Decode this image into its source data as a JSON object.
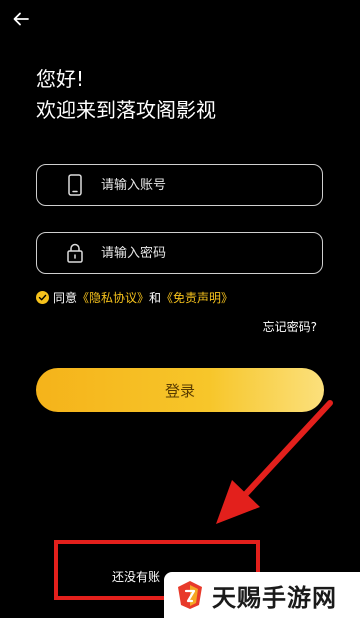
{
  "header": {
    "back_icon": "back-arrow-icon"
  },
  "greeting": {
    "line1": "您好!",
    "line2": "欢迎来到落攻阁影视"
  },
  "form": {
    "account": {
      "icon": "phone-icon",
      "placeholder": "请输入账号",
      "value": ""
    },
    "password": {
      "icon": "lock-icon",
      "placeholder": "请输入密码",
      "value": ""
    }
  },
  "agreement": {
    "checked": true,
    "prefix": "同意",
    "privacy_link": "《隐私协议》",
    "conjunction": "和",
    "disclaimer_link": "《免责声明》"
  },
  "forgot_password": "忘记密码?",
  "login_button": "登录",
  "register_prompt": "还没有账",
  "watermark": {
    "text": "天赐手游网"
  },
  "colors": {
    "background": "#000000",
    "accent": "#f6c21c",
    "annotation": "#e3201c",
    "button_text": "#5a3c00"
  }
}
